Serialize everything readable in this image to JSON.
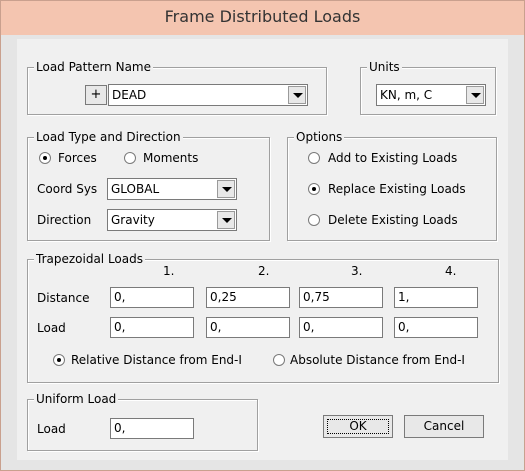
{
  "window": {
    "title": "Frame Distributed Loads"
  },
  "load_pattern": {
    "legend": "Load Pattern Name",
    "add_button": "+",
    "selected": "DEAD"
  },
  "units": {
    "legend": "Units",
    "selected": "KN, m, C"
  },
  "load_type": {
    "legend": "Load Type and Direction",
    "forces_label": "Forces",
    "moments_label": "Moments",
    "selected": "Forces",
    "coord_sys_label": "Coord Sys",
    "coord_sys_value": "GLOBAL",
    "direction_label": "Direction",
    "direction_value": "Gravity"
  },
  "options": {
    "legend": "Options",
    "add_label": "Add to Existing Loads",
    "replace_label": "Replace Existing Loads",
    "delete_label": "Delete Existing Loads",
    "selected": "Replace Existing Loads"
  },
  "trapezoidal": {
    "legend": "Trapezoidal Loads",
    "columns": [
      "1.",
      "2.",
      "3.",
      "4."
    ],
    "distance_label": "Distance",
    "distances": [
      "0,",
      "0,25",
      "0,75",
      "1,"
    ],
    "load_label": "Load",
    "loads": [
      "0,",
      "0,",
      "0,",
      "0,"
    ],
    "relative_label": "Relative Distance from End-I",
    "absolute_label": "Absolute Distance from End-I",
    "selected": "Relative Distance from End-I"
  },
  "uniform": {
    "legend": "Uniform Load",
    "load_label": "Load",
    "load_value": "0,"
  },
  "buttons": {
    "ok": "OK",
    "cancel": "Cancel"
  }
}
